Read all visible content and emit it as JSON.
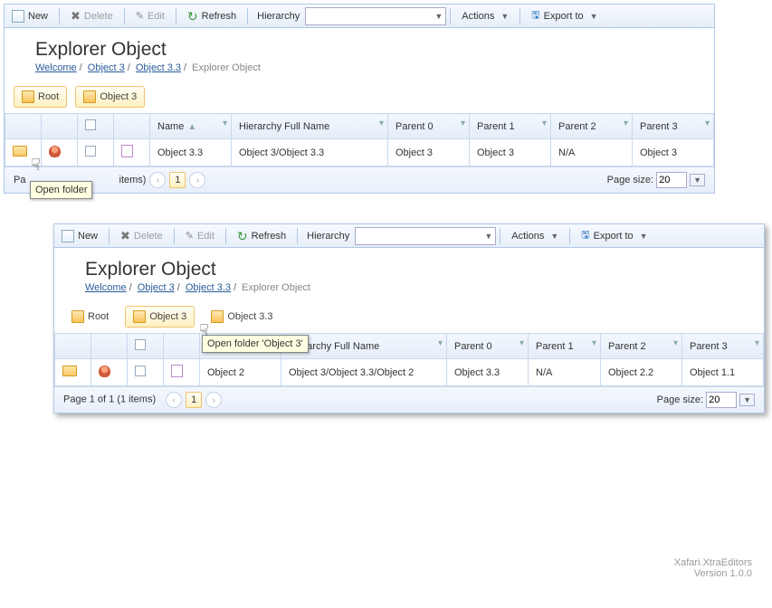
{
  "toolbar": {
    "new_label": "New",
    "delete_label": "Delete",
    "edit_label": "Edit",
    "refresh_label": "Refresh",
    "hierarchy_label": "Hierarchy",
    "actions_label": "Actions",
    "export_label": "Export to"
  },
  "title": "Explorer Object",
  "crumbs": {
    "welcome": "Welcome",
    "o3": "Object 3",
    "o33": "Object 3.3",
    "current": "Explorer Object"
  },
  "bc": {
    "root": "Root",
    "o3": "Object 3",
    "o33": "Object 3.3"
  },
  "cols": {
    "name": "Name",
    "hfull": "Hierarchy Full Name",
    "p0": "Parent 0",
    "p1": "Parent 1",
    "p2": "Parent 2",
    "p3": "Parent 3"
  },
  "row_top": {
    "name": "Object 3.3",
    "hfull": "Object 3/Object 3.3",
    "p0": "Object 3",
    "p1": "Object 3",
    "p2": "N/A",
    "p3": "Object 3"
  },
  "row_bot": {
    "name": "Object 2",
    "hfull": "Object 3/Object 3.3/Object 2",
    "p0": "Object 3.3",
    "p1": "N/A",
    "p2": "Object 2.2",
    "p3": "Object 1.1"
  },
  "pager": {
    "label_top": "Pa",
    "label_bot": "Page 1 of 1 (1 items)",
    "page_size_label": "Page size:",
    "page_size": "20",
    "page_num": "1",
    "items_tail": "items)"
  },
  "tooltips": {
    "open_folder": "Open folder",
    "open_folder_o3": "Open folder 'Object 3'"
  },
  "footer": {
    "name": "Xafari.XtraEditors",
    "ver": "Version 1.0.0"
  }
}
